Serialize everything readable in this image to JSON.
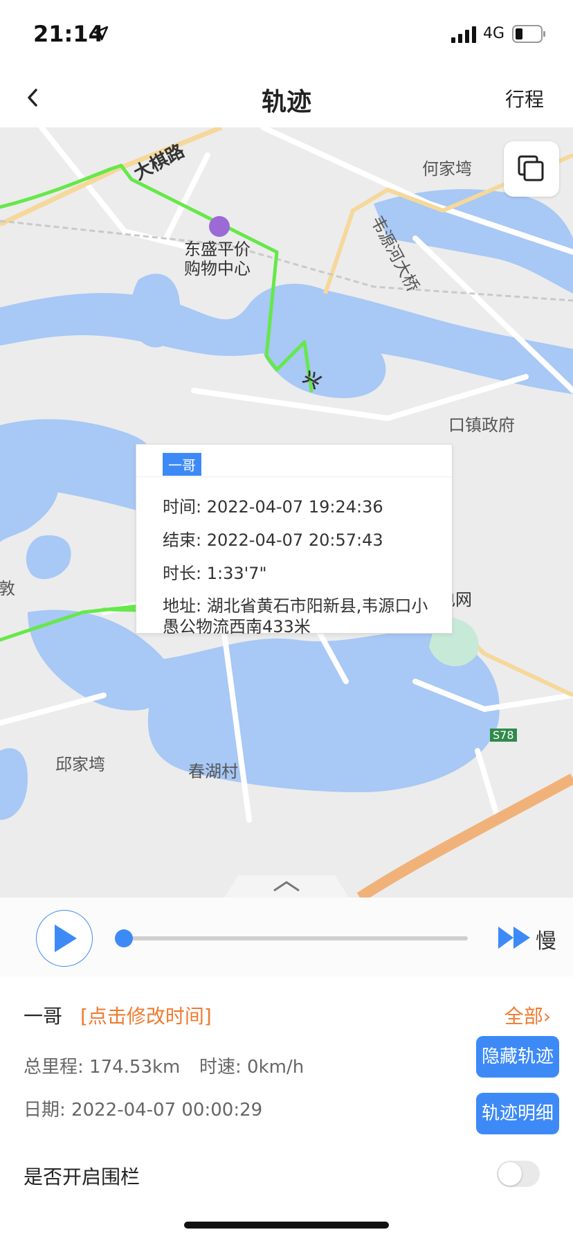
{
  "status_bar": {
    "time": "21:14",
    "network": "4G"
  },
  "nav": {
    "title": "轨迹",
    "right_link": "行程"
  },
  "map": {
    "labels": {
      "road_daqi": "大棋路",
      "hejiawan": "何家塆",
      "fengyuan_bridge": "韦源河大桥",
      "mall_line1": "东盛平价",
      "mall_line2": "购物中心",
      "town_gov": "口镇政府",
      "state_grid": "国家电网",
      "qiujiawan": "邱家塆",
      "chunhu": "春湖村",
      "road_s78": "S78",
      "edge_left": "敦",
      "road_fragment": "兴"
    },
    "track_color": "#66e84a",
    "water_color": "#a8c8f5"
  },
  "popup": {
    "tag": "一哥",
    "time": "时间: 2022-04-07 19:24:36",
    "end": "结束: 2022-04-07 20:57:43",
    "duration": "时长: 1:33'7\"",
    "address": "地址: 湖北省黄石市阳新县,韦源口小愚公物流西南433米"
  },
  "playback": {
    "speed_label": "慢",
    "progress": 0
  },
  "info": {
    "device_name": "一哥",
    "edit_time": "[点击修改时间]",
    "all_link": "全部›",
    "total_mileage": "总里程: 174.53km",
    "speed": "时速: 0km/h",
    "date": "日期:   2022-04-07 00:00:29",
    "hide_track_button": "隐藏轨迹",
    "track_detail_button": "轨迹明细"
  },
  "fence": {
    "label": "是否开启围栏",
    "enabled": false
  },
  "colors": {
    "accent": "#3d8af7",
    "orange": "#f07a2f"
  }
}
